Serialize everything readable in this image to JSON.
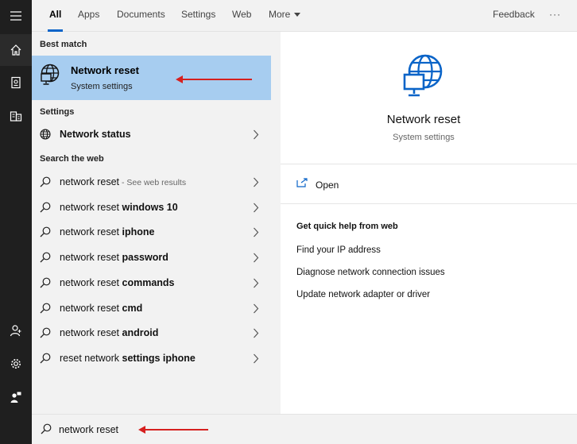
{
  "tabs": [
    {
      "label": "All",
      "active": true
    },
    {
      "label": "Apps"
    },
    {
      "label": "Documents"
    },
    {
      "label": "Settings"
    },
    {
      "label": "Web"
    },
    {
      "label": "More"
    }
  ],
  "header": {
    "feedback": "Feedback",
    "more_options": "···"
  },
  "results": {
    "best_match_label": "Best match",
    "best": {
      "title": "Network reset",
      "subtitle": "System settings",
      "icon": "globe-monitor-icon"
    },
    "settings_label": "Settings",
    "settings_items": [
      {
        "label": "Network status",
        "icon": "globe-icon"
      }
    ],
    "web_label": "Search the web",
    "web_items": [
      {
        "base": "network reset",
        "bold": "",
        "hint": " - See web results"
      },
      {
        "base": "network reset ",
        "bold": "windows 10",
        "hint": ""
      },
      {
        "base": "network reset ",
        "bold": "iphone",
        "hint": ""
      },
      {
        "base": "network reset ",
        "bold": "password",
        "hint": ""
      },
      {
        "base": "network reset ",
        "bold": "commands",
        "hint": ""
      },
      {
        "base": "network reset ",
        "bold": "cmd",
        "hint": ""
      },
      {
        "base": "network reset ",
        "bold": "android",
        "hint": ""
      },
      {
        "base": "reset network ",
        "bold": "settings iphone",
        "hint": ""
      }
    ]
  },
  "preview": {
    "title": "Network reset",
    "subtitle": "System settings",
    "open_label": "Open",
    "quick_help_label": "Get quick help from web",
    "quick_help": [
      "Find your IP address",
      "Diagnose network connection issues",
      "Update network adapter or driver"
    ]
  },
  "search": {
    "value": "network reset"
  },
  "colors": {
    "accent": "#0a64c8",
    "selection": "#a7cdf0",
    "rail": "#1f1f1f",
    "annotation": "#d6201f"
  }
}
